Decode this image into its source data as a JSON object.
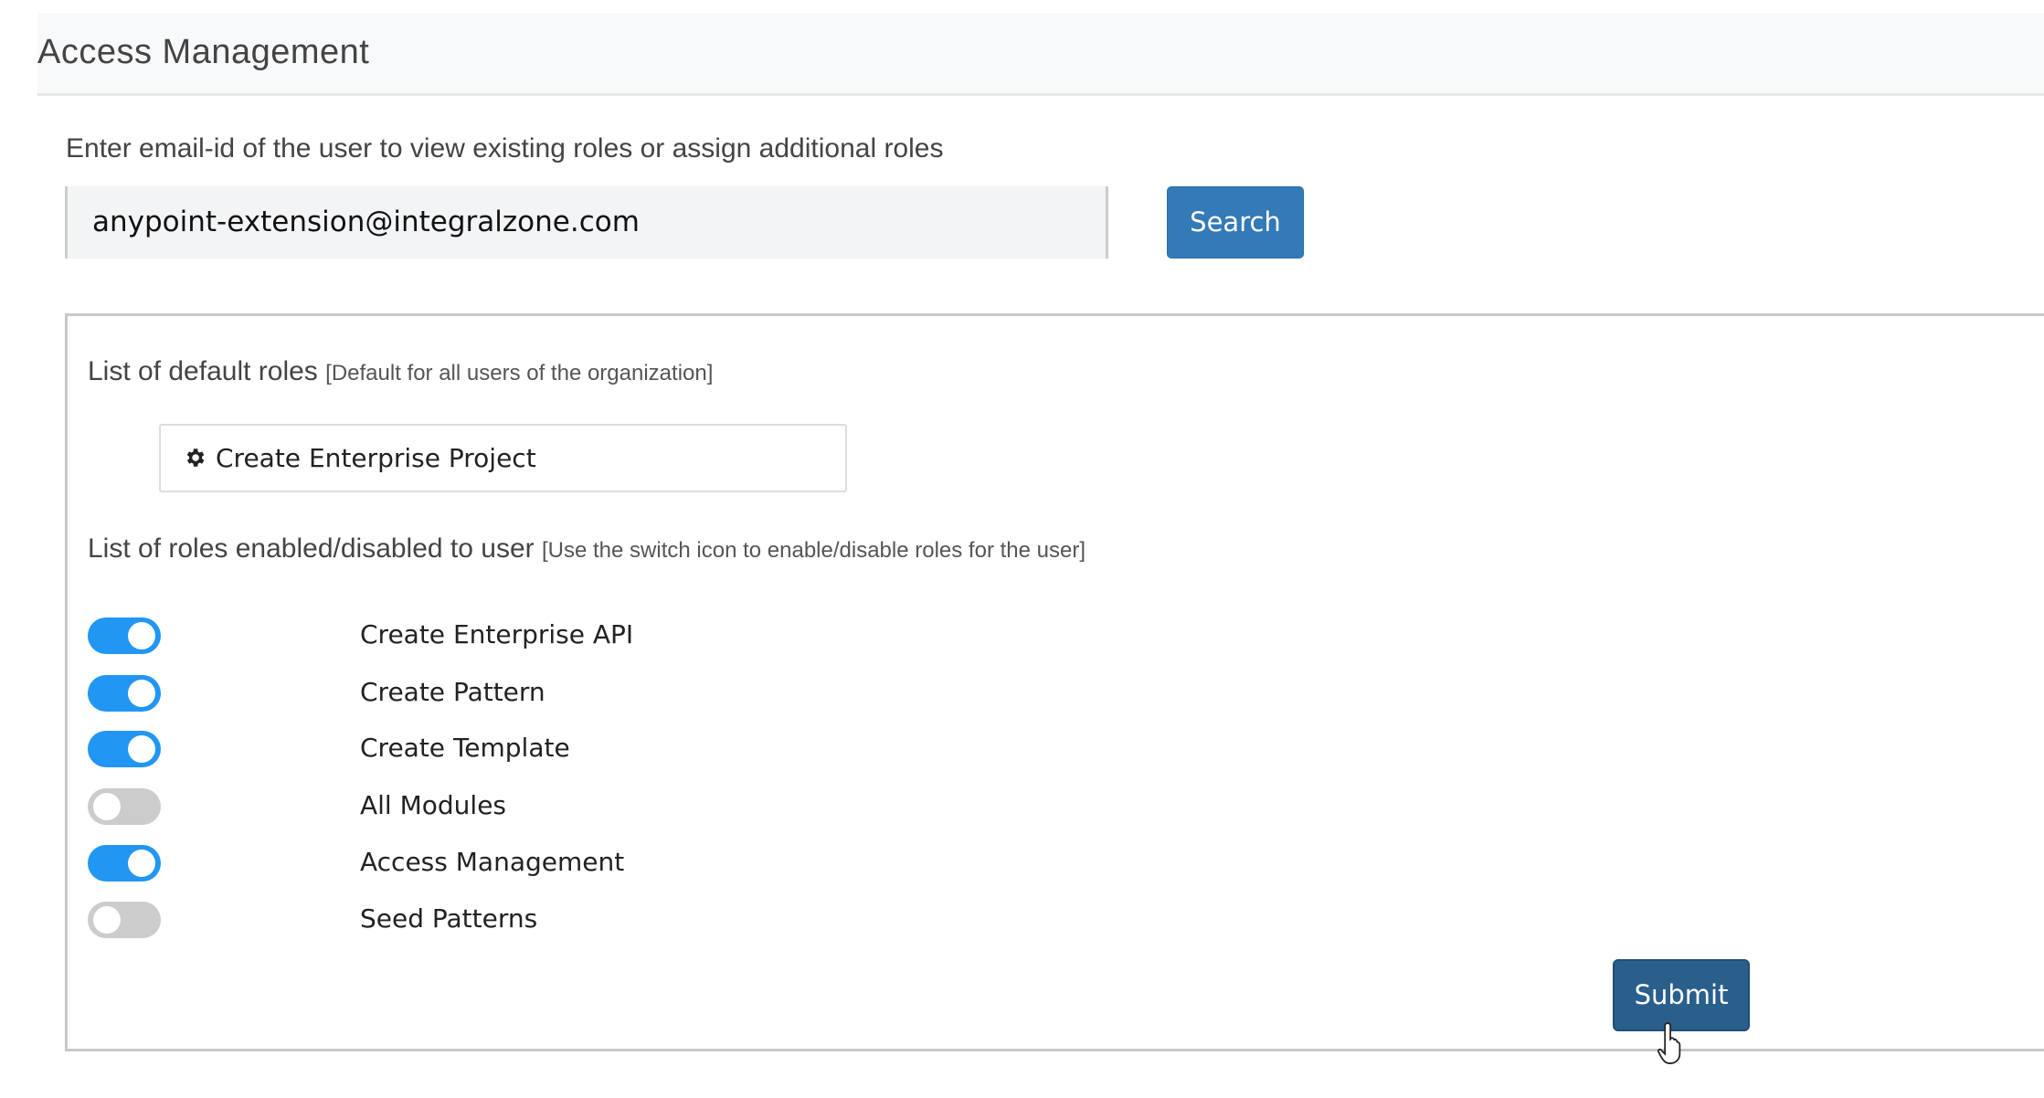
{
  "header": {
    "title": "Access Management"
  },
  "search": {
    "prompt": "Enter email-id of the user to view existing roles or assign additional roles",
    "email_value": "anypoint-extension@integralzone.com",
    "button_label": "Search"
  },
  "default_roles": {
    "heading": "List of default roles",
    "note": "[Default for all users of the organization]",
    "items": [
      {
        "label": "Create Enterprise Project",
        "icon": "gear-icon"
      }
    ]
  },
  "user_roles": {
    "heading": "List of roles enabled/disabled to user",
    "note": "[Use the switch icon to enable/disable roles for the user]",
    "items": [
      {
        "label": "Create Enterprise API",
        "enabled": true
      },
      {
        "label": "Create Pattern",
        "enabled": true
      },
      {
        "label": "Create Template",
        "enabled": true
      },
      {
        "label": "All Modules",
        "enabled": false
      },
      {
        "label": "Access Management",
        "enabled": true
      },
      {
        "label": "Seed Patterns",
        "enabled": false
      }
    ]
  },
  "submit_label": "Submit",
  "colors": {
    "toggle_on": "#2196f3",
    "toggle_off": "#cccccc",
    "search_button": "#337ab7",
    "submit_button": "#2a5f8c"
  }
}
